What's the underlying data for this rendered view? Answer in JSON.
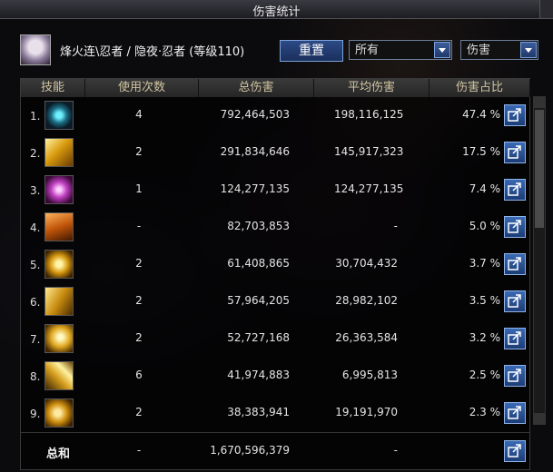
{
  "window": {
    "title": "伤害统计"
  },
  "character": {
    "name": "烽火连\\忍者 / 隐夜·忍者 (等级110)"
  },
  "controls": {
    "reset_label": "重置",
    "filter_select": "所有",
    "metric_select": "伤害"
  },
  "table": {
    "headers": [
      "技能",
      "使用次数",
      "总伤害",
      "平均伤害",
      "伤害占比"
    ],
    "rows": [
      {
        "index": "1.",
        "icon": "skill-icon-1",
        "uses": "4",
        "total": "792,464,503",
        "avg": "198,116,125",
        "pct": "47.4 %"
      },
      {
        "index": "2.",
        "icon": "skill-icon-2",
        "uses": "2",
        "total": "291,834,646",
        "avg": "145,917,323",
        "pct": "17.5 %"
      },
      {
        "index": "3.",
        "icon": "skill-icon-3",
        "uses": "1",
        "total": "124,277,135",
        "avg": "124,277,135",
        "pct": "7.4 %"
      },
      {
        "index": "4.",
        "icon": "skill-icon-4",
        "uses": "-",
        "total": "82,703,853",
        "avg": "-",
        "pct": "5.0 %"
      },
      {
        "index": "5.",
        "icon": "skill-icon-5",
        "uses": "2",
        "total": "61,408,865",
        "avg": "30,704,432",
        "pct": "3.7 %"
      },
      {
        "index": "6.",
        "icon": "skill-icon-6",
        "uses": "2",
        "total": "57,964,205",
        "avg": "28,982,102",
        "pct": "3.5 %"
      },
      {
        "index": "7.",
        "icon": "skill-icon-7",
        "uses": "2",
        "total": "52,727,168",
        "avg": "26,363,584",
        "pct": "3.2 %"
      },
      {
        "index": "8.",
        "icon": "skill-icon-8",
        "uses": "6",
        "total": "41,974,883",
        "avg": "6,995,813",
        "pct": "2.5 %"
      },
      {
        "index": "9.",
        "icon": "skill-icon-9",
        "uses": "2",
        "total": "38,383,941",
        "avg": "19,191,970",
        "pct": "2.3 %"
      }
    ],
    "total": {
      "label": "总和",
      "uses": "-",
      "total": "1,670,596,379",
      "avg": "-"
    }
  },
  "colors": {
    "header_text": "#cfc3a0",
    "button_blue": "#2c4a86"
  }
}
